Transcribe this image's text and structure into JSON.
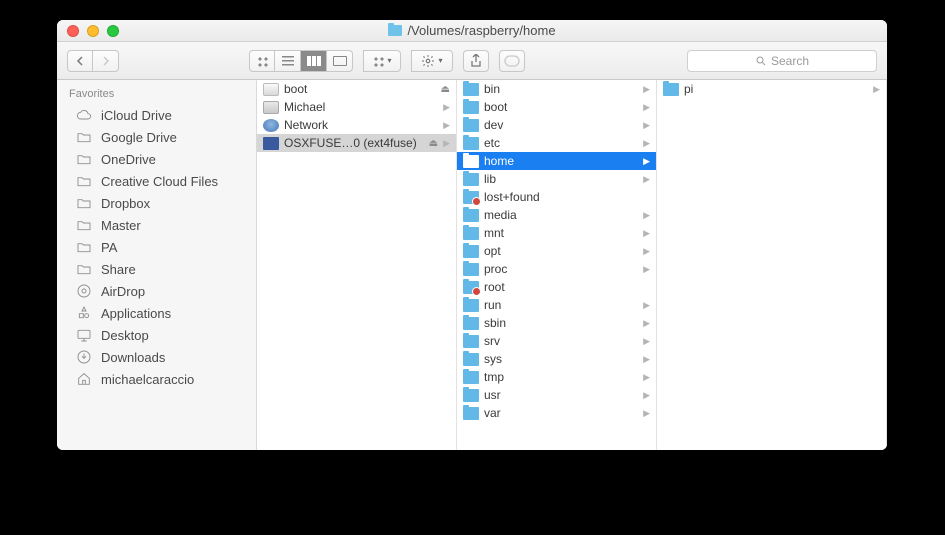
{
  "window": {
    "title": "/Volumes/raspberry/home"
  },
  "search": {
    "placeholder": "Search"
  },
  "sidebar": {
    "section": "Favorites",
    "items": [
      {
        "label": "iCloud Drive",
        "icon": "cloud"
      },
      {
        "label": "Google Drive",
        "icon": "folder-o"
      },
      {
        "label": "OneDrive",
        "icon": "folder-o"
      },
      {
        "label": "Creative Cloud Files",
        "icon": "folder-o"
      },
      {
        "label": "Dropbox",
        "icon": "folder-o"
      },
      {
        "label": "Master",
        "icon": "folder-o"
      },
      {
        "label": "PA",
        "icon": "folder-o"
      },
      {
        "label": "Share",
        "icon": "folder-o"
      },
      {
        "label": "AirDrop",
        "icon": "airdrop"
      },
      {
        "label": "Applications",
        "icon": "apps"
      },
      {
        "label": "Desktop",
        "icon": "desktop"
      },
      {
        "label": "Downloads",
        "icon": "downloads"
      },
      {
        "label": "michaelcaraccio",
        "icon": "home"
      }
    ]
  },
  "columns": {
    "c1": [
      {
        "label": "boot",
        "kind": "disk",
        "eject": true,
        "arrow": false
      },
      {
        "label": "Michael",
        "kind": "hd",
        "arrow": true
      },
      {
        "label": "Network",
        "kind": "net",
        "arrow": true
      },
      {
        "label": "OSXFUSE…0 (ext4fuse)",
        "kind": "fuse",
        "eject": true,
        "arrow": true,
        "selected": true
      }
    ],
    "c2": [
      {
        "label": "bin",
        "arrow": true
      },
      {
        "label": "boot",
        "arrow": true
      },
      {
        "label": "dev",
        "arrow": true
      },
      {
        "label": "etc",
        "arrow": true
      },
      {
        "label": "home",
        "arrow": true,
        "highlighted": true
      },
      {
        "label": "lib",
        "arrow": true
      },
      {
        "label": "lost+found",
        "locked": true
      },
      {
        "label": "media",
        "arrow": true
      },
      {
        "label": "mnt",
        "arrow": true
      },
      {
        "label": "opt",
        "arrow": true
      },
      {
        "label": "proc",
        "arrow": true
      },
      {
        "label": "root",
        "locked": true
      },
      {
        "label": "run",
        "arrow": true
      },
      {
        "label": "sbin",
        "arrow": true
      },
      {
        "label": "srv",
        "arrow": true
      },
      {
        "label": "sys",
        "arrow": true
      },
      {
        "label": "tmp",
        "arrow": true
      },
      {
        "label": "usr",
        "arrow": true
      },
      {
        "label": "var",
        "arrow": true
      }
    ],
    "c3": [
      {
        "label": "pi",
        "arrow": true
      }
    ]
  }
}
